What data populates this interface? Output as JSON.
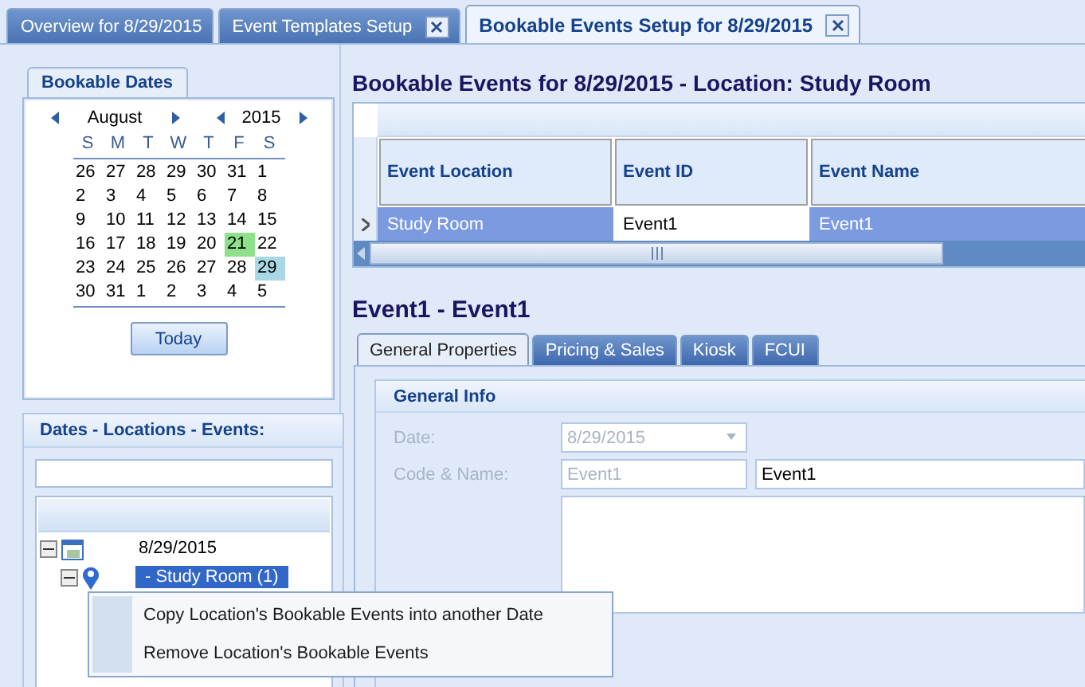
{
  "doc_tabs": [
    {
      "label": "Overview for 8/29/2015",
      "selected": false,
      "closable": false
    },
    {
      "label": "Event Templates Setup",
      "selected": false,
      "closable": true
    },
    {
      "label": "Bookable Events Setup for 8/29/2015",
      "selected": true,
      "closable": true
    }
  ],
  "calendar": {
    "tab": "Bookable Dates",
    "month": "August",
    "year": "2015",
    "weekdays": [
      "S",
      "M",
      "T",
      "W",
      "T",
      "F",
      "S"
    ],
    "weeks": [
      [
        {
          "day": "26",
          "selected": false,
          "marked": false
        },
        {
          "day": "27",
          "selected": false,
          "marked": false
        },
        {
          "day": "28",
          "selected": false,
          "marked": false
        },
        {
          "day": "29",
          "selected": false,
          "marked": false
        },
        {
          "day": "30",
          "selected": false,
          "marked": false
        },
        {
          "day": "31",
          "selected": false,
          "marked": false
        },
        {
          "day": "1",
          "selected": false,
          "marked": false
        }
      ],
      [
        {
          "day": "2",
          "selected": false,
          "marked": false
        },
        {
          "day": "3",
          "selected": false,
          "marked": false
        },
        {
          "day": "4",
          "selected": false,
          "marked": false
        },
        {
          "day": "5",
          "selected": false,
          "marked": false
        },
        {
          "day": "6",
          "selected": false,
          "marked": false
        },
        {
          "day": "7",
          "selected": false,
          "marked": false
        },
        {
          "day": "8",
          "selected": false,
          "marked": false
        }
      ],
      [
        {
          "day": "9",
          "selected": false,
          "marked": false
        },
        {
          "day": "10",
          "selected": false,
          "marked": false
        },
        {
          "day": "11",
          "selected": false,
          "marked": false
        },
        {
          "day": "12",
          "selected": false,
          "marked": false
        },
        {
          "day": "13",
          "selected": false,
          "marked": false
        },
        {
          "day": "14",
          "selected": false,
          "marked": false
        },
        {
          "day": "15",
          "selected": false,
          "marked": false
        }
      ],
      [
        {
          "day": "16",
          "selected": false,
          "marked": false
        },
        {
          "day": "17",
          "selected": false,
          "marked": false
        },
        {
          "day": "18",
          "selected": false,
          "marked": false
        },
        {
          "day": "19",
          "selected": false,
          "marked": false
        },
        {
          "day": "20",
          "selected": false,
          "marked": false
        },
        {
          "day": "21",
          "selected": false,
          "marked": true
        },
        {
          "day": "22",
          "selected": false,
          "marked": false
        }
      ],
      [
        {
          "day": "23",
          "selected": false,
          "marked": false
        },
        {
          "day": "24",
          "selected": false,
          "marked": false
        },
        {
          "day": "25",
          "selected": false,
          "marked": false
        },
        {
          "day": "26",
          "selected": false,
          "marked": false
        },
        {
          "day": "27",
          "selected": false,
          "marked": false
        },
        {
          "day": "28",
          "selected": false,
          "marked": false
        },
        {
          "day": "29",
          "selected": true,
          "marked": false
        }
      ],
      [
        {
          "day": "30",
          "selected": false,
          "marked": false
        },
        {
          "day": "31",
          "selected": false,
          "marked": false
        },
        {
          "day": "1",
          "selected": false,
          "marked": false
        },
        {
          "day": "2",
          "selected": false,
          "marked": false
        },
        {
          "day": "3",
          "selected": false,
          "marked": false
        },
        {
          "day": "4",
          "selected": false,
          "marked": false
        },
        {
          "day": "5",
          "selected": false,
          "marked": false
        }
      ]
    ],
    "today_button": "Today"
  },
  "tree_panel": {
    "title": "Dates - Locations - Events:",
    "nodes": [
      {
        "label": "8/29/2015",
        "selected": false,
        "expanded": true,
        "children": [
          {
            "label": "- Study Room (1)",
            "selected": true,
            "expanded": true
          }
        ]
      }
    ]
  },
  "context_menu": {
    "items": [
      "Copy Location's Bookable Events into another Date",
      "Remove Location's Bookable Events"
    ]
  },
  "events_title": "Bookable Events for 8/29/2015  -  Location: Study Room",
  "grid": {
    "columns": [
      "Event Location",
      "Event ID",
      "Event Name"
    ],
    "rows": [
      {
        "selected": true,
        "cells": [
          "Study Room",
          "Event1",
          "Event1"
        ]
      }
    ]
  },
  "detail": {
    "title": "Event1  -  Event1",
    "tabs": [
      {
        "label": "General Properties",
        "selected": true
      },
      {
        "label": "Pricing & Sales",
        "selected": false
      },
      {
        "label": "Kiosk",
        "selected": false
      },
      {
        "label": "FCUI",
        "selected": false
      }
    ],
    "group_title": "General Info",
    "date_label": "Date:",
    "date_value": "8/29/2015",
    "code_label": "Code & Name:",
    "code_value": "Event1",
    "name_value": "Event1"
  }
}
